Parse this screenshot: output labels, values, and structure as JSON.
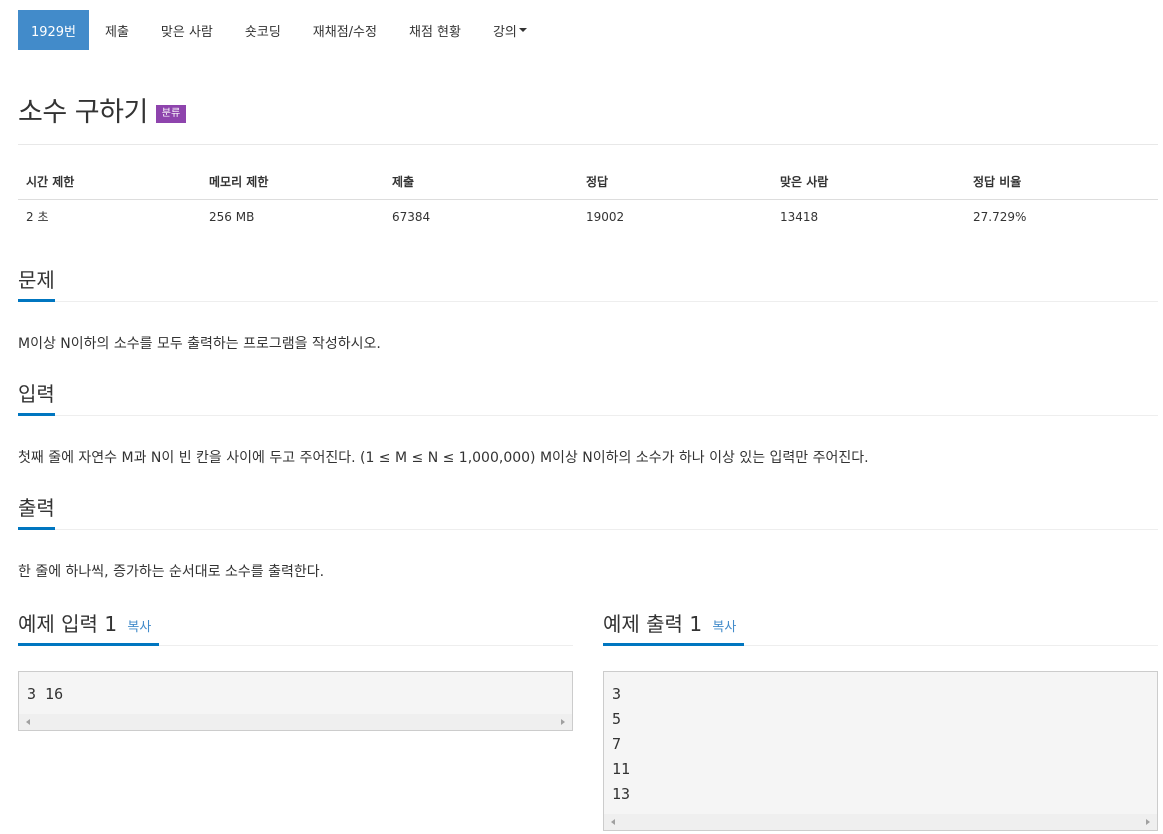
{
  "tabs": [
    {
      "label": "1929번",
      "active": true
    },
    {
      "label": "제출"
    },
    {
      "label": "맞은 사람"
    },
    {
      "label": "숏코딩"
    },
    {
      "label": "재채점/수정"
    },
    {
      "label": "채점 현황"
    },
    {
      "label": "강의"
    }
  ],
  "problem": {
    "title": "소수 구하기",
    "badge": "분류"
  },
  "stats": {
    "headers": [
      "시간 제한",
      "메모리 제한",
      "제출",
      "정답",
      "맞은 사람",
      "정답 비율"
    ],
    "values": [
      "2 초",
      "256 MB",
      "67384",
      "19002",
      "13418",
      "27.729%"
    ]
  },
  "sections": {
    "problem": {
      "heading": "문제",
      "text": "M이상 N이하의 소수를 모두 출력하는 프로그램을 작성하시오."
    },
    "input": {
      "heading": "입력",
      "text": "첫째 줄에 자연수 M과 N이 빈 칸을 사이에 두고 주어진다. (1 ≤ M ≤ N ≤ 1,000,000) M이상 N이하의 소수가 하나 이상 있는 입력만 주어진다."
    },
    "output": {
      "heading": "출력",
      "text": "한 줄에 하나씩, 증가하는 순서대로 소수를 출력한다."
    }
  },
  "examples": {
    "input": {
      "heading": "예제 입력 1",
      "copy": "복사",
      "lines": [
        "3 16"
      ]
    },
    "output": {
      "heading": "예제 출력 1",
      "copy": "복사",
      "lines": [
        "3",
        "5",
        "7",
        "11",
        "13"
      ]
    }
  },
  "colors": {
    "tab_active": "#428bca",
    "badge": "#8e44ad",
    "heading_underline": "#0076c0",
    "link": "#428bca"
  }
}
